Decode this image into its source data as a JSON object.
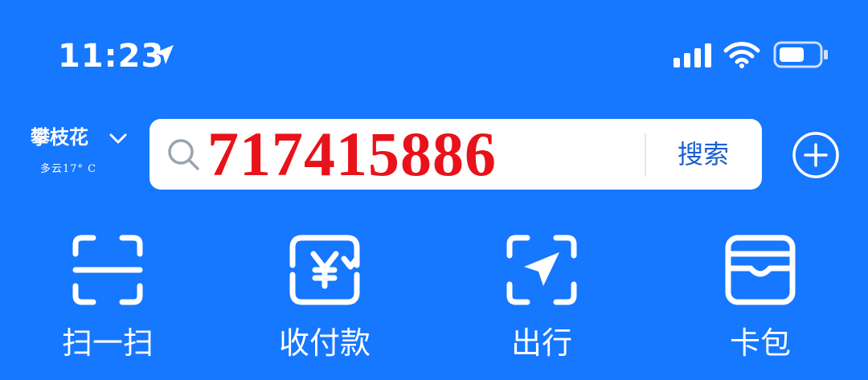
{
  "status_bar": {
    "time": "11:23",
    "icons": [
      "location-arrow-icon",
      "cellular-signal-icon",
      "wifi-icon",
      "battery-icon"
    ]
  },
  "header": {
    "city": "攀枝花",
    "weather": "多云17° C",
    "search_value": "717415886",
    "search_button": "搜索",
    "icons": [
      "chevron-down-icon",
      "search-icon",
      "add-circle-icon"
    ]
  },
  "quick_actions": [
    {
      "label": "扫一扫",
      "icon": "scan-icon"
    },
    {
      "label": "收付款",
      "icon": "payment-icon"
    },
    {
      "label": "出行",
      "icon": "travel-icon"
    },
    {
      "label": "卡包",
      "icon": "card-wallet-icon"
    }
  ],
  "colors": {
    "background": "#1677ff",
    "search_text": "#e8121a",
    "search_button_text": "#1a5fcf"
  }
}
